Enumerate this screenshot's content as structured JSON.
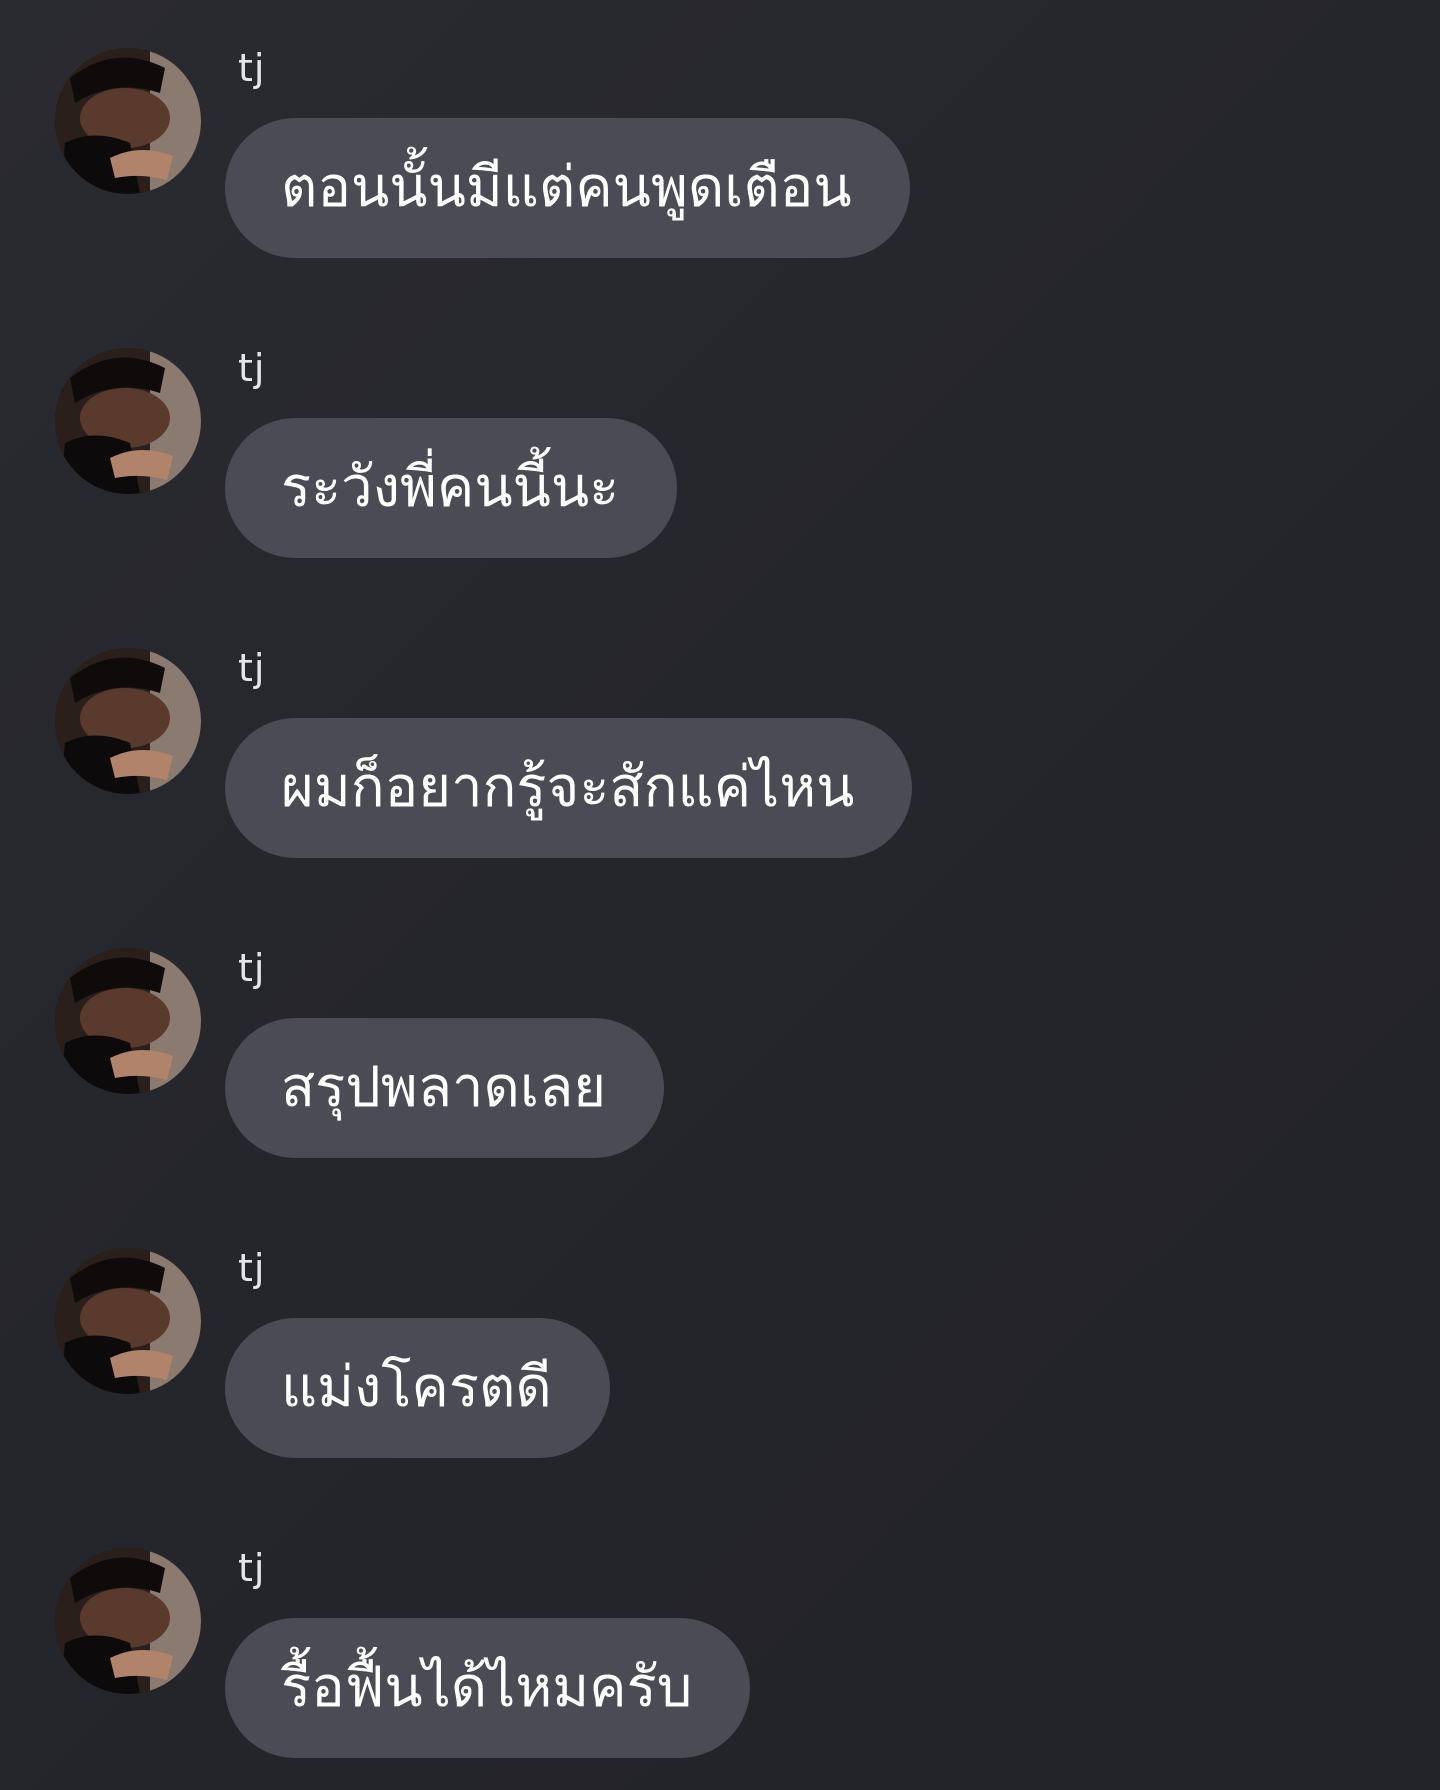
{
  "app": {
    "background": "#25262c",
    "bubble_color": "#4a4b55",
    "text_color": "#ffffff",
    "username_color": "#e6e6ea"
  },
  "messages": [
    {
      "sender": "tj",
      "avatar_icon": "user-avatar-photo",
      "text": "ตอนนั้นมีแต่คนพูดเตือน"
    },
    {
      "sender": "tj",
      "avatar_icon": "user-avatar-photo",
      "text": "ระวังพี่คนนี้นะ"
    },
    {
      "sender": "tj",
      "avatar_icon": "user-avatar-photo",
      "text": "ผมก็อยากรู้จะสักแค่ไหน"
    },
    {
      "sender": "tj",
      "avatar_icon": "user-avatar-photo",
      "text": "สรุปพลาดเลย"
    },
    {
      "sender": "tj",
      "avatar_icon": "user-avatar-photo",
      "text": "แม่งโครตดี"
    },
    {
      "sender": "tj",
      "avatar_icon": "user-avatar-photo",
      "text": "รื้อฟื้นได้ไหมครับ"
    }
  ]
}
